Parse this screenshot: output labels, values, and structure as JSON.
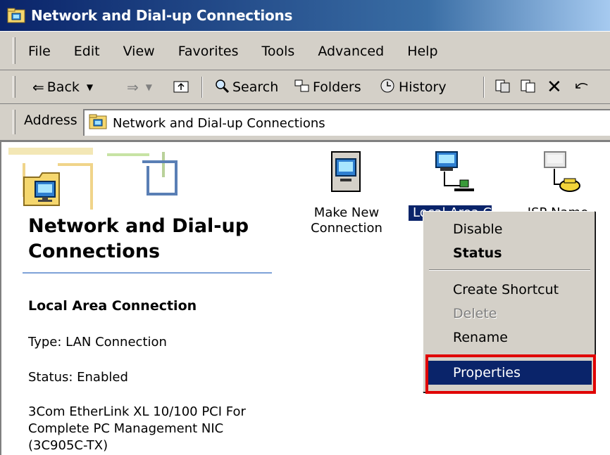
{
  "window": {
    "title": "Network and Dial-up Connections"
  },
  "menu": [
    "File",
    "Edit",
    "View",
    "Favorites",
    "Tools",
    "Advanced",
    "Help"
  ],
  "toolbar": {
    "back": "Back",
    "search": "Search",
    "folders": "Folders",
    "history": "History"
  },
  "address": {
    "label": "Address",
    "value": "Network and Dial-up Connections"
  },
  "left_pane": {
    "title": "Network and Dial-up Connections",
    "selected_name": "Local Area Connection",
    "type": "Type: LAN Connection",
    "status": "Status: Enabled",
    "adapter": "3Com EtherLink XL 10/100 PCI For Complete PC Management NIC (3C905C-TX)"
  },
  "icons": [
    {
      "label": "Make New Connection"
    },
    {
      "label": "Local Area Connection",
      "visible_label": "Local Area Co"
    },
    {
      "label": "ISP Name"
    }
  ],
  "context_menu": {
    "items": [
      {
        "label": "Disable"
      },
      {
        "label": "Status"
      },
      {
        "label": "Create Shortcut"
      },
      {
        "label": "Delete"
      },
      {
        "label": "Rename"
      },
      {
        "label": "Properties"
      }
    ]
  },
  "colors": {
    "accent": "#0a246a",
    "highlight_border": "#e00000",
    "chrome": "#d4d0c8"
  }
}
